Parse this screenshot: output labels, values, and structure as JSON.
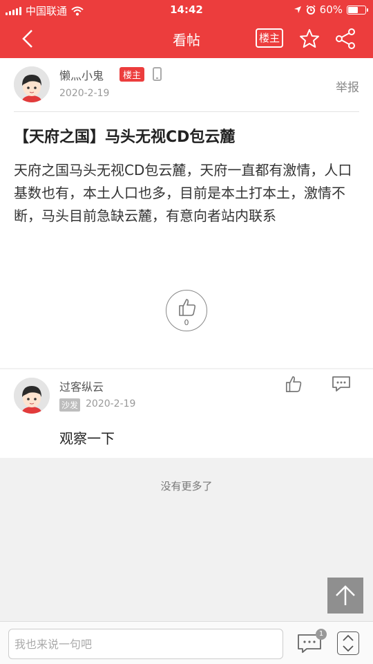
{
  "statusbar": {
    "carrier": "中国联通",
    "time": "14:42",
    "battery": "60%",
    "battery_level": 0.6,
    "icons": [
      "signal-icon",
      "wifi-icon",
      "location-icon",
      "alarm-icon",
      "battery-icon"
    ]
  },
  "navbar": {
    "title": "看帖",
    "louzhu_label": "楼主",
    "icons": [
      "back-icon",
      "star-icon",
      "share-icon"
    ]
  },
  "post": {
    "author": "懒灬小鬼",
    "owner_badge": "楼主",
    "date": "2020-2-19",
    "report_label": "举报",
    "title": "【天府之国】马头无视CD包云麓",
    "body": "天府之国马头无视CD包云麓，天府一直都有激情，人口基数也有，本土人口也多，目前是本土打本土，激情不断，马头目前急缺云麓，有意向者站内联系",
    "like_count": "0"
  },
  "reply": {
    "author": "过客纵云",
    "floor_badge": "沙发",
    "date": "2020-2-19",
    "text": "观察一下"
  },
  "footer": {
    "no_more": "没有更多了",
    "input_placeholder": "我也来说一句吧",
    "comment_count": "1"
  },
  "colors": {
    "brand": "#ec3d3d",
    "background": "#f1f1f1"
  }
}
